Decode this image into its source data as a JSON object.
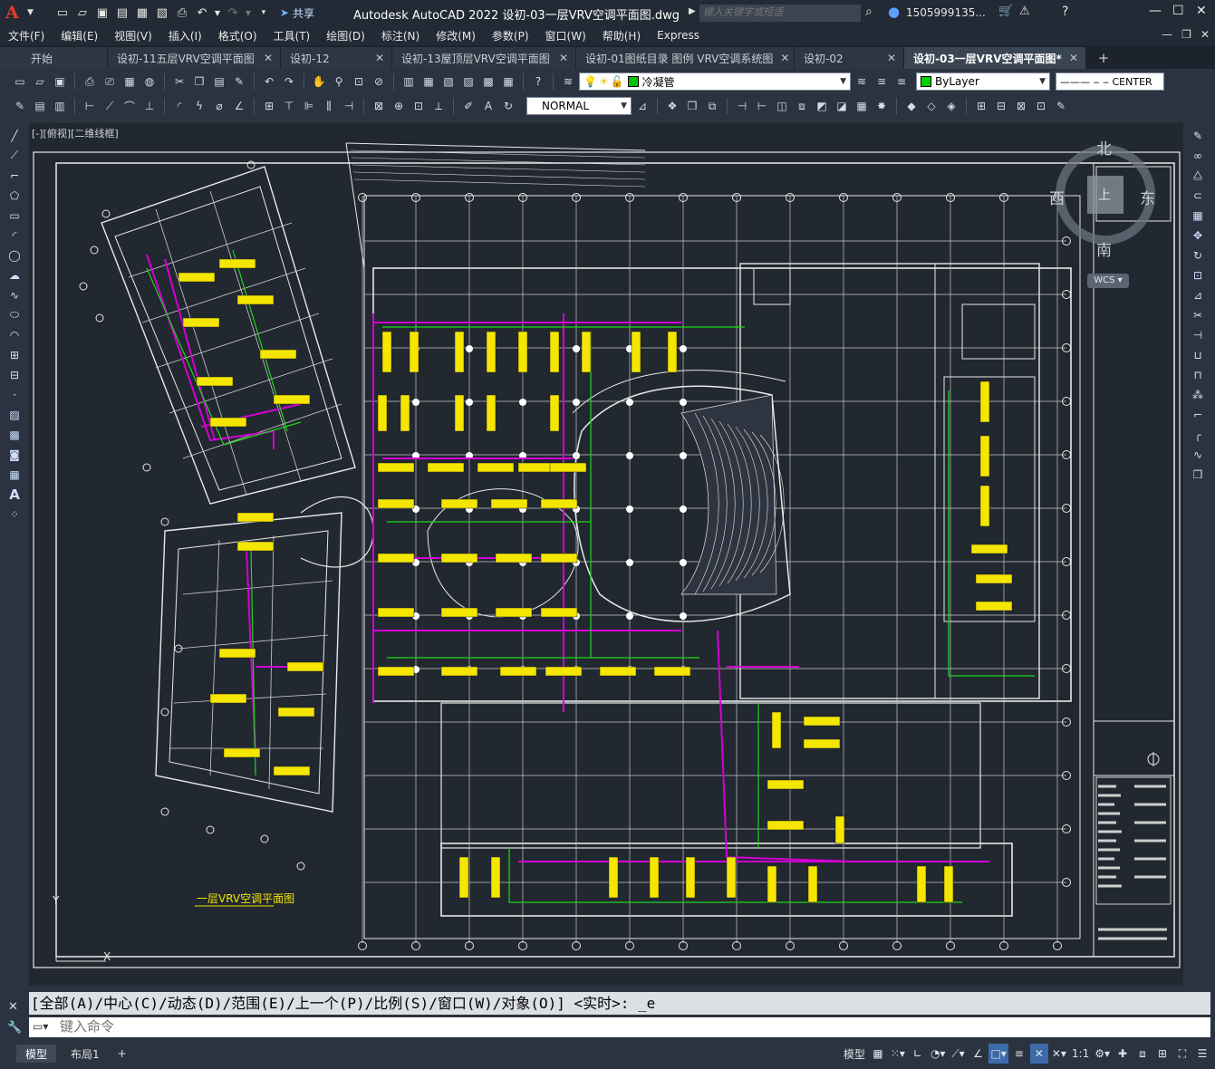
{
  "app": {
    "logo": "A",
    "title": "Autodesk AutoCAD 2022    设初-03一层VRV空调平面图.dwg",
    "share_label": "共享",
    "search_placeholder": "键入关键字或短语",
    "user_name": "1505999135...",
    "icons": [
      "new-icon",
      "open-icon",
      "save-icon",
      "saveas-icon",
      "plot-icon",
      "undo-icon",
      "redo-icon",
      "share-icon",
      "search-icon",
      "user-icon",
      "cart-icon",
      "autodesk-icon",
      "help-icon"
    ]
  },
  "menu": {
    "items": [
      "文件(F)",
      "编辑(E)",
      "视图(V)",
      "插入(I)",
      "格式(O)",
      "工具(T)",
      "绘图(D)",
      "标注(N)",
      "修改(M)",
      "参数(P)",
      "窗口(W)",
      "帮助(H)",
      "Express"
    ]
  },
  "tabs": [
    {
      "label": "开始",
      "closable": false
    },
    {
      "label": "设初-11五层VRV空调平面图",
      "closable": true
    },
    {
      "label": "设初-12",
      "closable": true
    },
    {
      "label": "设初-13屋顶层VRV空调平面图",
      "closable": true
    },
    {
      "label": "设初-01图纸目录 图例 VRV空调系统图",
      "closable": true
    },
    {
      "label": "设初-02",
      "closable": true
    },
    {
      "label": "设初-03一层VRV空调平面图*",
      "closable": true,
      "active": true
    }
  ],
  "toolbar": {
    "layer_name": "冷凝管",
    "layer_color": "#00c000",
    "color_value": "ByLayer",
    "linetype_value": "CENTER",
    "textstyle_value": "NORMAL"
  },
  "drawing": {
    "view_label": "[-][俯视][二维线框]",
    "plan_title": "一层VRV空调平面图",
    "compass": {
      "north": "北",
      "south": "南",
      "east": "东",
      "west": "西",
      "center": "上"
    },
    "wcs_label": "WCS"
  },
  "command": {
    "history": "[全部(A)/中心(C)/动态(D)/范围(E)/上一个(P)/比例(S)/窗口(W)/对象(O)] <实时>: _e",
    "placeholder": "键入命令"
  },
  "status": {
    "layouts": [
      {
        "label": "模型",
        "active": true
      },
      {
        "label": "布局1",
        "active": false
      }
    ],
    "model_label": "模型",
    "scale_label": "1:1"
  }
}
